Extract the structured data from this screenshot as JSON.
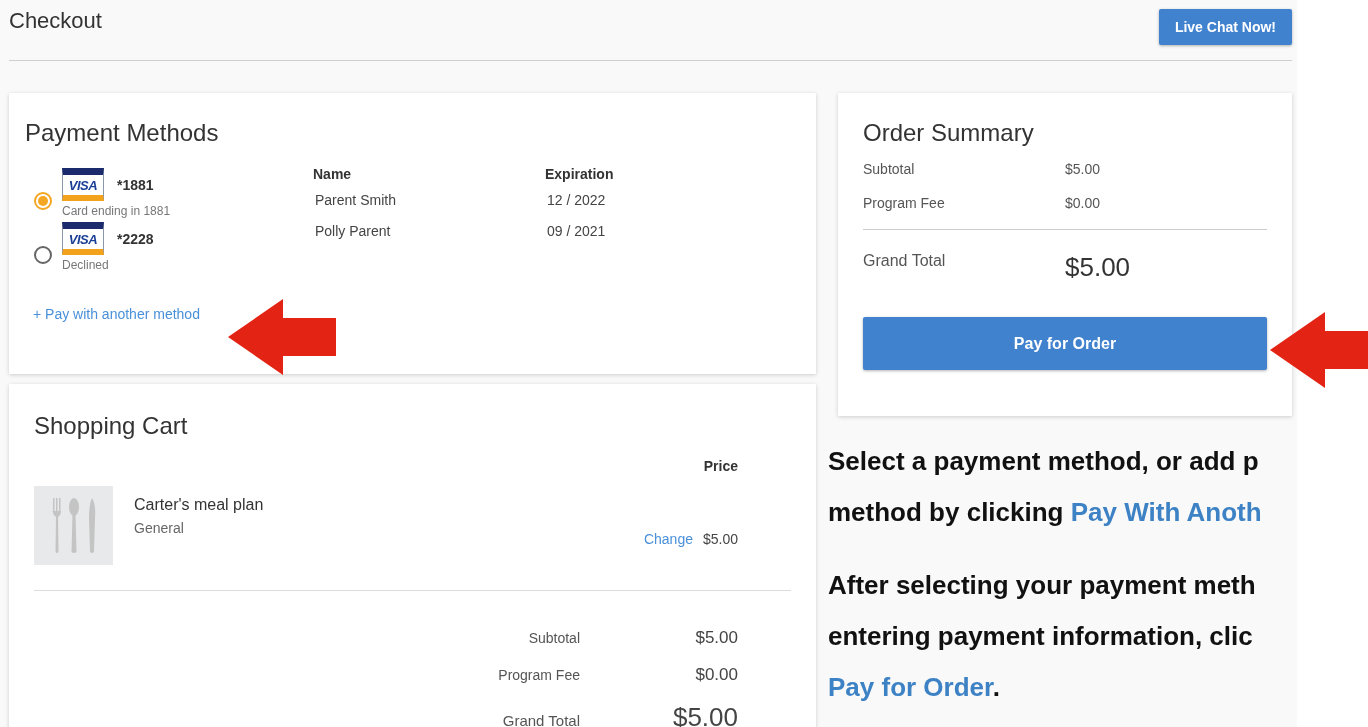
{
  "header": {
    "title": "Checkout",
    "chat_button": "Live Chat Now!"
  },
  "payment_methods": {
    "title": "Payment Methods",
    "columns": [
      "Name",
      "Expiration"
    ],
    "methods": [
      {
        "brand": "VISA",
        "number": "*1881",
        "note": "Card ending in 1881",
        "name": "Parent Smith",
        "expiration": "12 / 2022",
        "selected": true
      },
      {
        "brand": "VISA",
        "number": "*2228",
        "note": "Declined",
        "name": "Polly Parent",
        "expiration": "09 / 2021",
        "selected": false
      }
    ],
    "add_link": "+ Pay with another method"
  },
  "cart": {
    "title": "Shopping Cart",
    "price_header": "Price",
    "items": [
      {
        "name": "Carter's meal plan",
        "category": "General",
        "change_link": "Change",
        "price": "$5.00"
      }
    ],
    "totals": [
      {
        "label": "Subtotal",
        "value": "$5.00",
        "grand": false
      },
      {
        "label": "Program Fee",
        "value": "$0.00",
        "grand": false
      },
      {
        "label": "Grand Total",
        "value": "$5.00",
        "grand": true
      }
    ]
  },
  "order_summary": {
    "title": "Order Summary",
    "rows": [
      {
        "label": "Subtotal",
        "value": "$5.00",
        "grand": false
      },
      {
        "label": "Program Fee",
        "value": "$0.00",
        "grand": false
      },
      {
        "label": "Grand Total",
        "value": "$5.00",
        "grand": true
      }
    ],
    "pay_button": "Pay for Order"
  },
  "instructions": [
    {
      "lines": [
        [
          {
            "text": "Select a payment method, or add p",
            "highlight": false
          }
        ],
        [
          {
            "text": "method by clicking ",
            "highlight": false
          },
          {
            "text": "Pay With Anoth",
            "highlight": true
          }
        ]
      ]
    },
    {
      "lines": [
        [
          {
            "text": "After selecting your payment meth",
            "highlight": false
          }
        ],
        [
          {
            "text": "entering payment information, clic",
            "highlight": false
          }
        ],
        [
          {
            "text": "Pay for Order",
            "highlight": true
          },
          {
            "text": ".",
            "highlight": false
          }
        ]
      ]
    }
  ]
}
